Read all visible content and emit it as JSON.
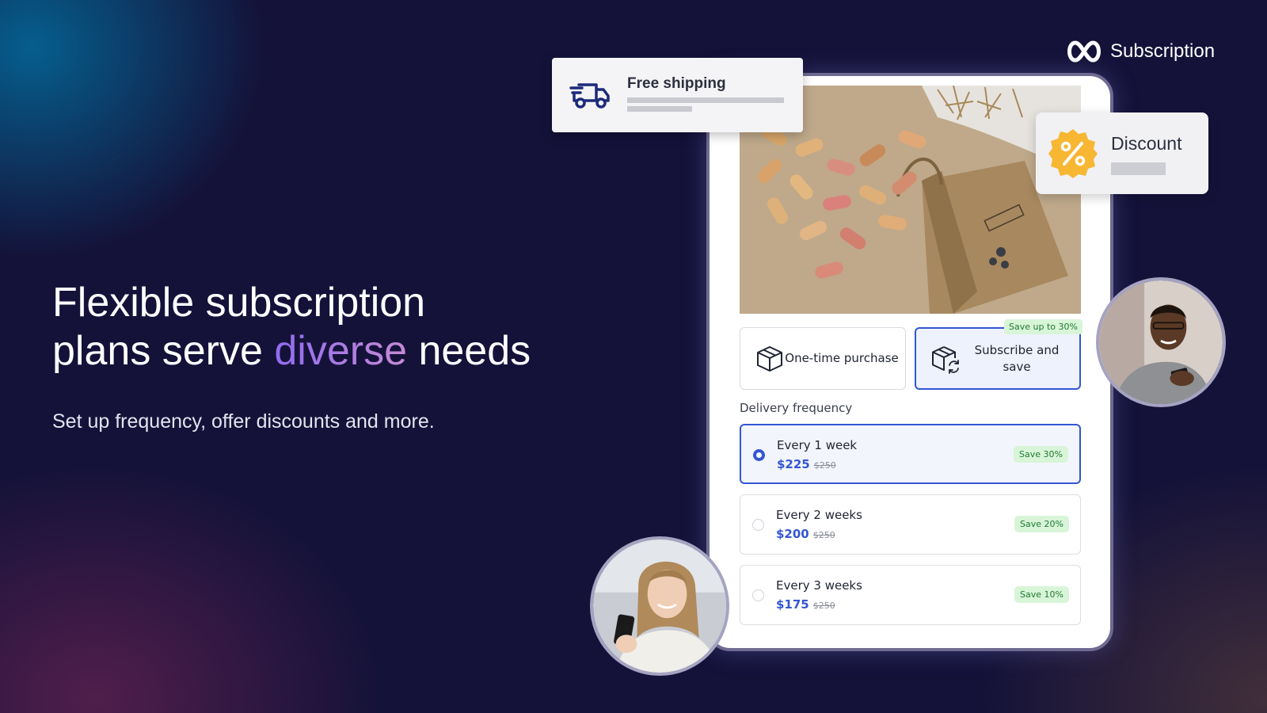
{
  "brand": {
    "name": "Subscription",
    "icon": "infinity-icon"
  },
  "hero": {
    "headline_line1": "Flexible subscription",
    "headline_line2_start": "plans serve ",
    "headline_accent": "diverse",
    "headline_line2_end": " needs",
    "subline": "Set up frequency, offer discounts and more."
  },
  "shipping_card": {
    "title": "Free shipping",
    "icon": "truck-icon"
  },
  "discount_card": {
    "title": "Discount",
    "icon": "percent-seal-icon"
  },
  "purchase_options": [
    {
      "label": "One-time purchase",
      "icon": "box-icon",
      "selected": false
    },
    {
      "label": "Subscribe and save",
      "icon": "box-refresh-icon",
      "selected": true,
      "tag": "Save up to 30%"
    }
  ],
  "delivery": {
    "title": "Delivery frequency",
    "options": [
      {
        "name": "Every 1 week",
        "price": "$225",
        "old_price": "$250",
        "badge": "Save 30%",
        "selected": true
      },
      {
        "name": "Every 2 weeks",
        "price": "$200",
        "old_price": "$250",
        "badge": "Save 20%",
        "selected": false
      },
      {
        "name": "Every 3 weeks",
        "price": "$175",
        "old_price": "$250",
        "badge": "Save 10%",
        "selected": false
      }
    ]
  },
  "colors": {
    "background": "#141239",
    "accent_blue": "#3256d3",
    "badge_bg": "#d8f5d8",
    "badge_text": "#217a33",
    "discount_seal": "#f7b733"
  }
}
